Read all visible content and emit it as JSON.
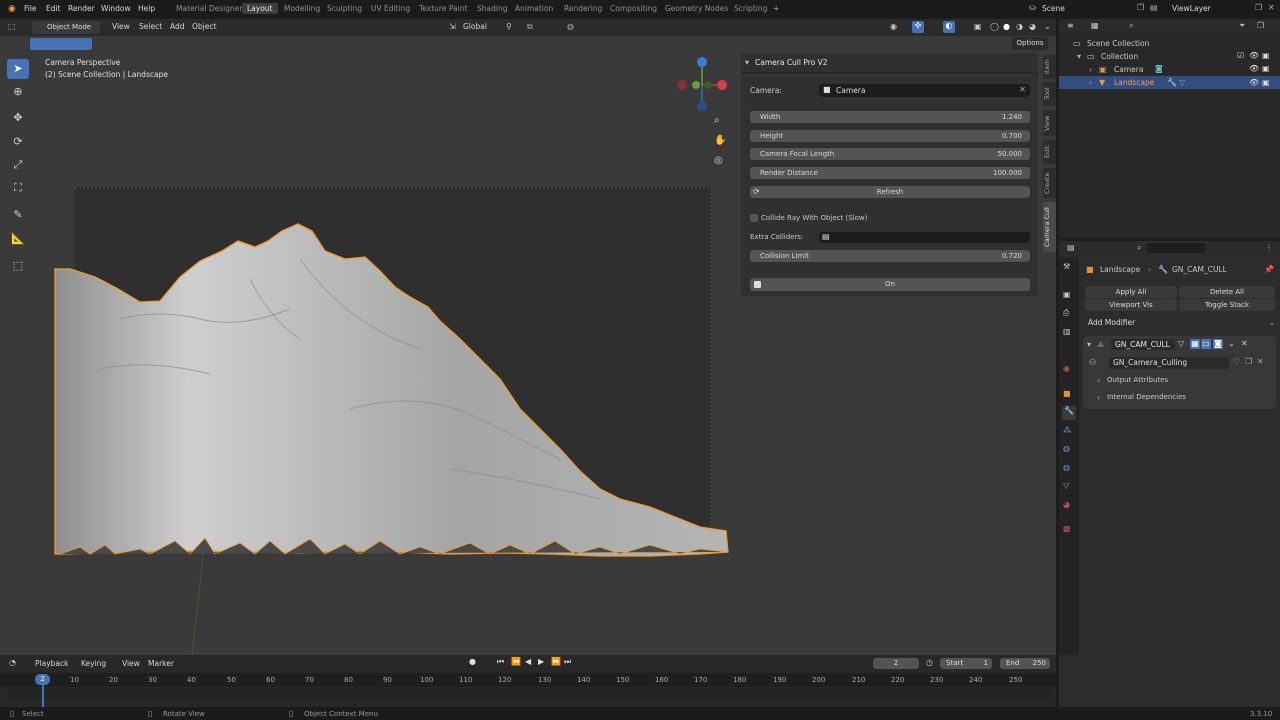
{
  "menus": [
    "File",
    "Edit",
    "Render",
    "Window",
    "Help"
  ],
  "workspaces": [
    "Material Designer",
    "Layout",
    "Modelling",
    "Sculpting",
    "UV Editing",
    "Texture Paint",
    "Shading",
    "Animation",
    "Rendering",
    "Compositing",
    "Geometry Nodes",
    "Scripting"
  ],
  "active_workspace": "Layout",
  "scene": "Scene",
  "view_layer": "ViewLayer",
  "viewport": {
    "mode": "Object Mode",
    "menus": [
      "View",
      "Select",
      "Add",
      "Object"
    ],
    "transform_orientation": "Global",
    "options_label": "Options",
    "overlay_title": "Camera Perspective",
    "overlay_subtitle": "(2) Scene Collection | Landscape"
  },
  "addon_panel": {
    "title": "Camera Cull Pro V2",
    "camera_label": "Camera:",
    "camera_value": "Camera",
    "fields": [
      {
        "label": "Width",
        "value": "1.240"
      },
      {
        "label": "Height",
        "value": "0.700"
      },
      {
        "label": "Camera Focal Length",
        "value": "50.000"
      },
      {
        "label": "Render Distance",
        "value": "100.000"
      }
    ],
    "refresh_label": "Refresh",
    "collide_label": "Collide Ray With Object (Slow)",
    "extra_colliders_label": "Extra Colliders:",
    "collision_limit_label": "Collision Limit",
    "collision_limit_value": "0.720",
    "on_label": "On"
  },
  "sidebar_tabs": [
    "Item",
    "Tool",
    "View",
    "Edit",
    "Create",
    "Camera Cull"
  ],
  "outliner": {
    "root": "Scene Collection",
    "collection": "Collection",
    "items": [
      "Camera",
      "Landscape"
    ]
  },
  "properties": {
    "breadcrumb_object": "Landscape",
    "breadcrumb_modifier": "GN_CAM_CULL",
    "apply_all": "Apply All",
    "delete_all": "Delete All",
    "viewport_vis": "Viewport Vis",
    "toggle_stack": "Toggle Stack",
    "add_modifier": "Add Modifier",
    "modifier_name": "GN_CAM_CULL",
    "node_group": "GN_Camera_Culling",
    "subpanels": [
      "Output Attributes",
      "Internal Dependencies"
    ]
  },
  "timeline": {
    "menus": [
      "Playback",
      "Keying",
      "View",
      "Marker"
    ],
    "current_frame": "2",
    "start_label": "Start",
    "start": "1",
    "end_label": "End",
    "end": "250",
    "ticks": [
      "2",
      "10",
      "20",
      "30",
      "40",
      "50",
      "60",
      "70",
      "80",
      "90",
      "100",
      "110",
      "120",
      "130",
      "140",
      "150",
      "160",
      "170",
      "180",
      "190",
      "200",
      "210",
      "220",
      "230",
      "240",
      "250"
    ]
  },
  "status": {
    "select": "Select",
    "rotate": "Rotate View",
    "context": "Object Context Menu",
    "version": "3.3.10"
  },
  "colors": {
    "accent": "#4772b3",
    "selection": "#f39a2c",
    "bg": "#3a3a3a"
  }
}
